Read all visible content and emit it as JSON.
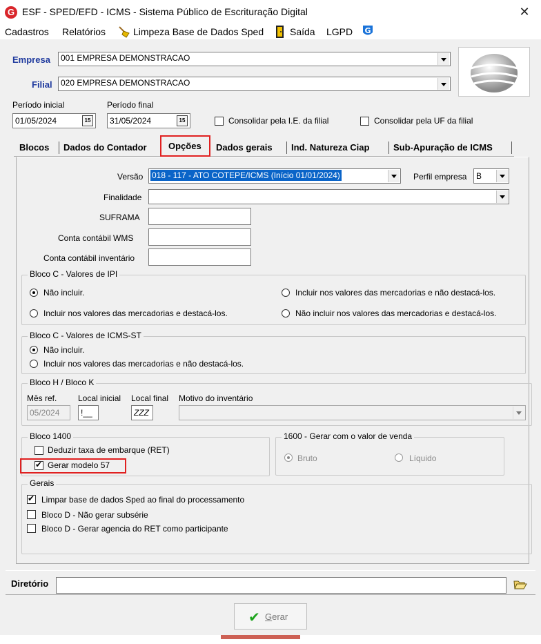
{
  "window": {
    "title": "ESF - SPED/EFD - ICMS - Sistema Público de Escrituração Digital",
    "logo_letter": "G",
    "close_glyph": "✕"
  },
  "menu": {
    "cadastros": "Cadastros",
    "relatorios": "Relatórios",
    "limpeza": "Limpeza Base de Dados Sped",
    "saida": "Saída",
    "lgpd": "LGPD"
  },
  "empresa": {
    "label": "Empresa",
    "value": "001 EMPRESA DEMONSTRACAO"
  },
  "filial": {
    "label": "Filial",
    "value": "020 EMPRESA DEMONSTRACAO"
  },
  "periodo": {
    "inicial_label": "Período inicial",
    "inicial_value": "01/05/2024",
    "final_label": "Período final",
    "final_value": "31/05/2024",
    "calendar_glyph": "15"
  },
  "consolidar": {
    "ie_label": "Consolidar pela I.E. da filial",
    "ie_checked": false,
    "uf_label": "Consolidar pela UF da filial",
    "uf_checked": false
  },
  "tabs": [
    {
      "label": "Blocos",
      "active": false
    },
    {
      "label": "Dados do Contador",
      "active": false
    },
    {
      "label": "Opções",
      "active": true
    },
    {
      "label": "Dados gerais",
      "active": false
    },
    {
      "label": "Ind. Natureza Ciap",
      "active": false
    },
    {
      "label": "Sub-Apuração de ICMS",
      "active": false
    }
  ],
  "opcoes": {
    "versao_label": "Versão",
    "versao_value": "018 - 117 - ATO COTEPE/ICMS (Início  01/01/2024)",
    "perfil_label": "Perfil empresa",
    "perfil_value": "B",
    "finalidade_label": "Finalidade",
    "finalidade_value": "",
    "suframa_label": "SUFRAMA",
    "suframa_value": "",
    "conta_wms_label": "Conta contábil WMS",
    "conta_wms_value": "",
    "conta_inv_label": "Conta contábil inventário",
    "conta_inv_value": ""
  },
  "bloco_c_ipi": {
    "title": "Bloco C - Valores de IPI",
    "options": [
      {
        "label": "Não incluir.",
        "checked": true
      },
      {
        "label": "Incluir nos valores das mercadorias e não destacá-los.",
        "checked": false
      },
      {
        "label": "Incluir nos valores das mercadorias e destacá-los.",
        "checked": false
      },
      {
        "label": "Não incluir nos valores das mercadorias e destacá-los.",
        "checked": false
      }
    ]
  },
  "bloco_c_icmsst": {
    "title": "Bloco C - Valores de ICMS-ST",
    "options": [
      {
        "label": "Não incluir.",
        "checked": true
      },
      {
        "label": "Incluir nos valores das mercadorias e não destacá-los.",
        "checked": false
      }
    ]
  },
  "bloco_hk": {
    "title": "Bloco H / Bloco K",
    "mes_ref_label": "Mês ref.",
    "mes_ref_value": "05/2024",
    "local_inicial_label": "Local inicial",
    "local_inicial_value": "!__",
    "local_final_label": "Local final",
    "local_final_value": "ZZZ",
    "motivo_label": "Motivo do inventário",
    "motivo_value": ""
  },
  "bloco_1400": {
    "title": "Bloco 1400",
    "deduzir_label": "Deduzir taxa de embarque (RET)",
    "deduzir_checked": false,
    "gerar57_label": "Gerar modelo 57",
    "gerar57_checked": true
  },
  "bloco_1600": {
    "title": "1600 - Gerar com o valor de venda",
    "bruto_label": "Bruto",
    "bruto_checked": true,
    "liquido_label": "Líquido",
    "liquido_checked": false
  },
  "gerais": {
    "title": "Gerais",
    "options": [
      {
        "label": "Limpar base de dados Sped ao final do processamento",
        "checked": true
      },
      {
        "label": "Bloco D - Não gerar subsérie",
        "checked": false
      },
      {
        "label": "Bloco D - Gerar agencia do RET como participante",
        "checked": false
      }
    ]
  },
  "diretorio": {
    "label": "Diretório",
    "value": ""
  },
  "gerar_button": {
    "label": "Gerar",
    "mnemonic": "G",
    "rest": "erar"
  },
  "colors": {
    "label_blue": "#1f3a9e",
    "highlight": "#0a64c8",
    "annotation_red": "#e02020",
    "check_green": "#1da41d"
  },
  "icons": {
    "limpeza": "broom-icon",
    "saida": "exit-door-icon",
    "lgpd": "shield-g-icon",
    "company_logo": "sphere-logo-icon",
    "folder": "folder-open-icon"
  }
}
